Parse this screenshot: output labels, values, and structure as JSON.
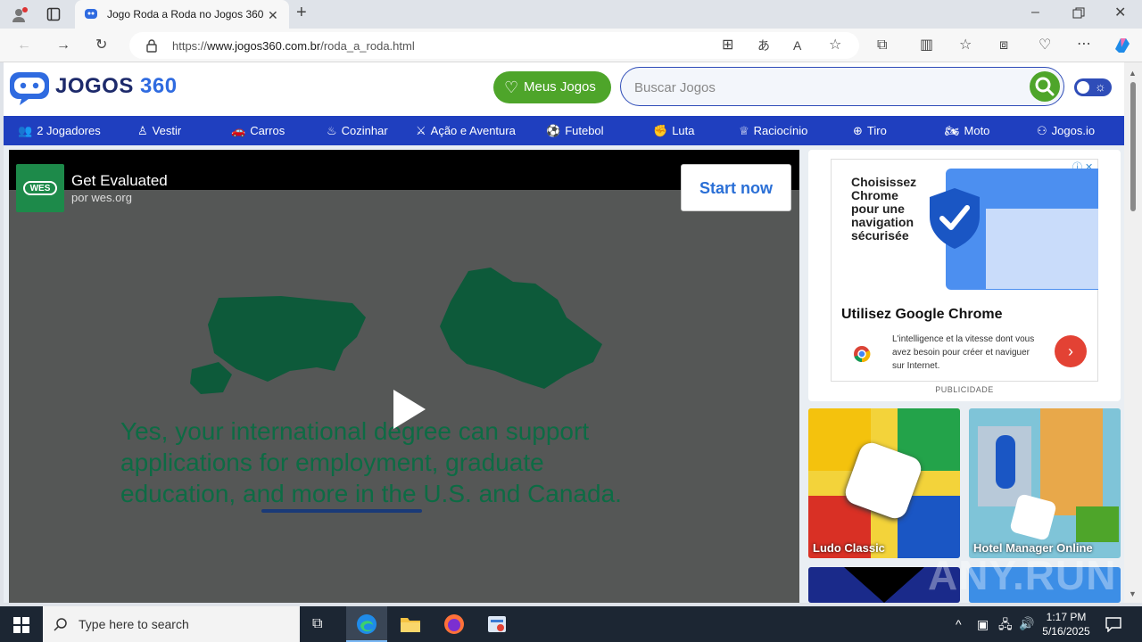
{
  "browser": {
    "tab_title": "Jogo Roda a Roda no Jogos 360",
    "url_prefix": "https://",
    "url_host": "www.jogos360.com.br",
    "url_path": "/roda_a_roda.html"
  },
  "site": {
    "logo_text_a": "JOGOS",
    "logo_text_b": "360",
    "meus_jogos": "Meus Jogos",
    "search_placeholder": "Buscar Jogos"
  },
  "nav": [
    {
      "label": "2 Jogadores",
      "icon": "players-icon"
    },
    {
      "label": "Vestir",
      "icon": "dress-icon"
    },
    {
      "label": "Carros",
      "icon": "car-icon"
    },
    {
      "label": "Cozinhar",
      "icon": "chef-hat-icon"
    },
    {
      "label": "Ação e Aventura",
      "icon": "action-icon"
    },
    {
      "label": "Futebol",
      "icon": "soccer-ball-icon"
    },
    {
      "label": "Luta",
      "icon": "fight-icon"
    },
    {
      "label": "Raciocínio",
      "icon": "brain-icon"
    },
    {
      "label": "Tiro",
      "icon": "target-icon"
    },
    {
      "label": "Moto",
      "icon": "motorcycle-icon"
    },
    {
      "label": "Jogos.io",
      "icon": "io-icon"
    }
  ],
  "video_ad": {
    "title": "Get Evaluated",
    "sponsor": "por wes.org",
    "cta": "Start now",
    "logo": "WES",
    "text_line1": "Yes, your international degree can support",
    "text_line2": "applications for employment, graduate",
    "text_line3": "education, and more in the U.S. and Canada."
  },
  "side_ad": {
    "headline": "Choisissez Chrome pour une navigation sécurisée",
    "title": "Utilisez Google Chrome",
    "body": "L'intelligence et la vitesse dont vous avez besoin pour créer et naviguer sur Internet.",
    "label": "PUBLICIDADE"
  },
  "games": [
    {
      "name": "Ludo Classic"
    },
    {
      "name": "Hotel Manager Online"
    }
  ],
  "taskbar": {
    "search_placeholder": "Type here to search",
    "time": "1:17 PM",
    "date": "5/16/2025"
  },
  "watermark": "ANY.RUN"
}
